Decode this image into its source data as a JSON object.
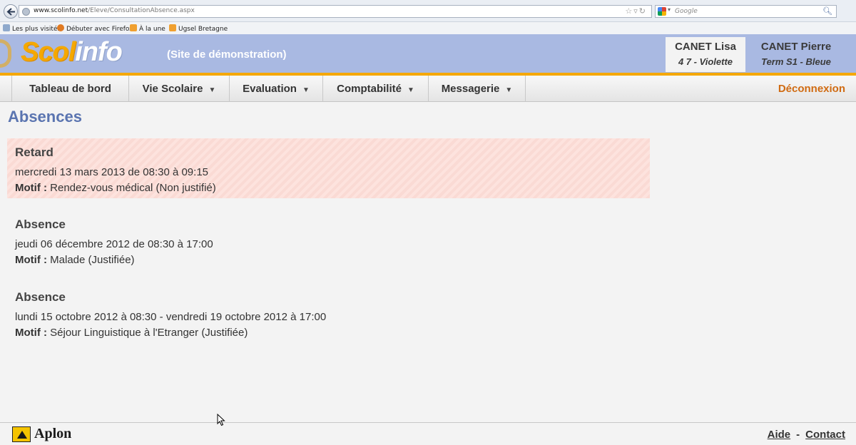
{
  "browser": {
    "url_domain": "www.scolinfo.net",
    "url_path": "/Eleve/ConsultationAbsence.aspx",
    "search_placeholder": "Google",
    "bookmarks": [
      "Les plus visités",
      "Débuter avec Firefox",
      "À la une",
      "Ugsel Bretagne"
    ]
  },
  "header": {
    "logo_part1": "Scol",
    "logo_part2": "info",
    "demo_label": "(Site de démonstration)",
    "users": [
      {
        "name": "CANET Lisa",
        "class": "4 7 - Violette"
      },
      {
        "name": "CANET Pierre",
        "class": "Term S1 - Bleue"
      }
    ]
  },
  "nav": {
    "items": [
      {
        "label": "Tableau de bord"
      },
      {
        "label": "Vie Scolaire"
      },
      {
        "label": "Evaluation"
      },
      {
        "label": "Comptabilité"
      },
      {
        "label": "Messagerie"
      }
    ],
    "logout": "Déconnexion"
  },
  "page": {
    "title": "Absences",
    "motif_label": "Motif :",
    "entries": [
      {
        "type": "Retard",
        "date": "mercredi 13 mars 2013 de 08:30 à 09:15",
        "motif": "Rendez-vous médical (Non justifié)"
      },
      {
        "type": "Absence",
        "date": "jeudi 06 décembre 2012 de 08:30 à 17:00",
        "motif": "Malade (Justifiée)"
      },
      {
        "type": "Absence",
        "date": "lundi 15 octobre 2012 à 08:30 - vendredi 19 octobre 2012 à 17:00",
        "motif": "Séjour Linguistique à l'Etranger (Justifiée)"
      }
    ]
  },
  "footer": {
    "brand": "Aplon",
    "help": "Aide",
    "separator": "-",
    "contact": "Contact"
  },
  "colors": {
    "header_bg": "#a9b9e2",
    "accent_orange": "#f5a800",
    "title_blue": "#5a74b0",
    "logout_orange": "#d06b12",
    "retard_bg": "#fde3de"
  }
}
